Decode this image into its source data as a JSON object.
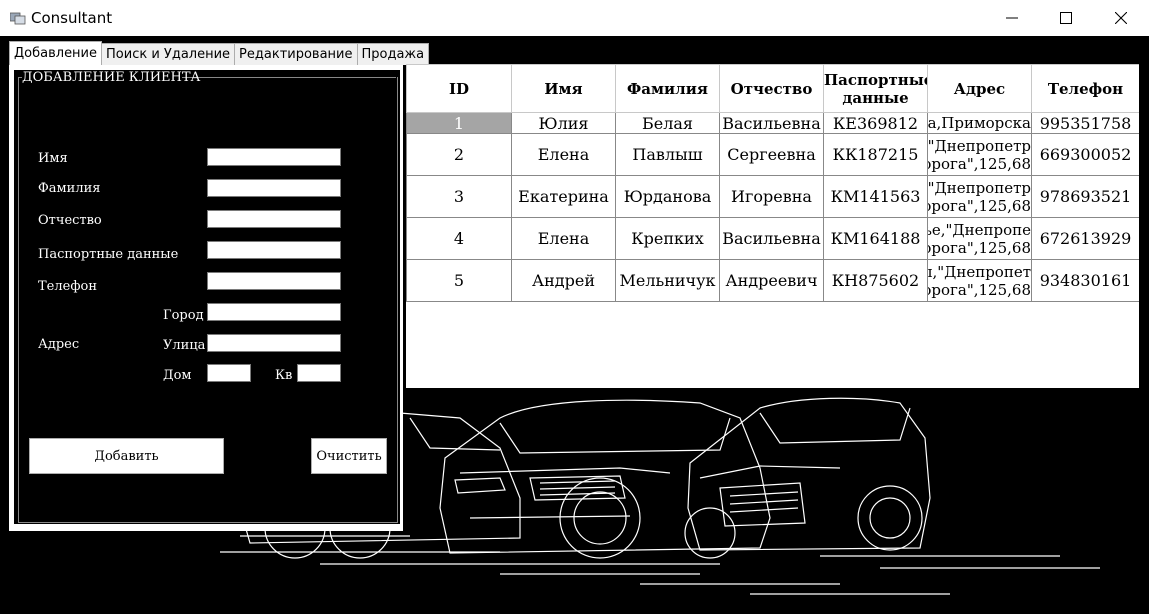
{
  "window": {
    "title": "Consultant",
    "minimize_glyph": "—",
    "maximize_glyph": "☐",
    "close_glyph": "✕"
  },
  "tabs": [
    {
      "label": "Добавление",
      "active": true
    },
    {
      "label": "Поиск и Удаление",
      "active": false
    },
    {
      "label": "Редактирование",
      "active": false
    },
    {
      "label": "Продажа",
      "active": false
    }
  ],
  "form": {
    "group_title": "ДОБАВЛЕНИЕ КЛИЕНТА",
    "first_name_label": "Имя",
    "last_name_label": "Фамилия",
    "patronymic_label": "Отчество",
    "passport_label": "Паспортные данные",
    "phone_label": "Телефон",
    "address_label": "Адрес",
    "city_label": "Город",
    "street_label": "Улица",
    "house_label": "Дом",
    "apt_label": "Кв",
    "add_button": "Добавить",
    "clear_button": "Очистить"
  },
  "grid": {
    "headers": [
      "ID",
      "Имя",
      "Фамилия",
      "Отчество",
      "Паспортные данные",
      "Адрес",
      "Телефон"
    ],
    "rows": [
      {
        "id": "1",
        "name": "Юлия",
        "surname": "Белая",
        "patronymic": "Васильевна",
        "passport": "КЕ369812",
        "address_line1": "сса,Приморска",
        "address_line2": "",
        "phone": "995351758"
      },
      {
        "id": "2",
        "name": "Елена",
        "surname": "Павлыш",
        "patronymic": "Сергеевна",
        "passport": "КК187215",
        "address_line1": "а,\"Днепропетр",
        "address_line2": "орога\",125,68",
        "phone": "669300052"
      },
      {
        "id": "3",
        "name": "Екатерина",
        "surname": "Юрданова",
        "patronymic": "Игоревна",
        "passport": "КМ141563",
        "address_line1": "а,\"Днепропетр",
        "address_line2": "орога\",125,68",
        "phone": "978693521"
      },
      {
        "id": "4",
        "name": "Елена",
        "surname": "Крепких",
        "patronymic": "Васильевна",
        "passport": "КМ164188",
        "address_line1": "ье,\"Днепропе",
        "address_line2": "орога\",125,68",
        "phone": "672613929"
      },
      {
        "id": "5",
        "name": "Андрей",
        "surname": "Мельничук",
        "patronymic": "Андреевич",
        "passport": "КН875602",
        "address_line1": "цы,\"Днепропет",
        "address_line2": "орога\",125,68",
        "phone": "934830161"
      }
    ],
    "selected_color": "#a5a5a5"
  },
  "background_image": "cars-line-art"
}
